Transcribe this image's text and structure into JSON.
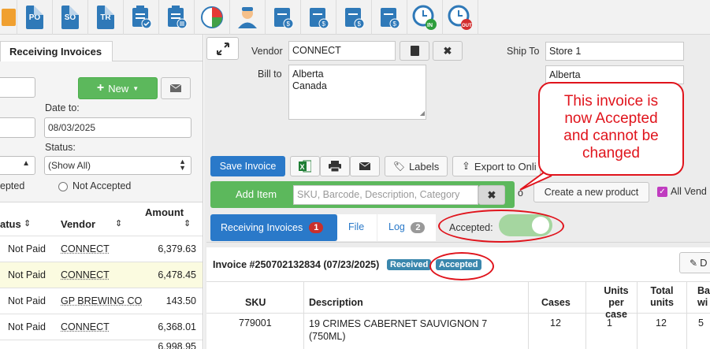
{
  "toolbar": {
    "icons": [
      "store-icon",
      "po-icon",
      "so-icon",
      "tr-icon",
      "checklist-approve-icon",
      "checklist-icon",
      "pie-chart-icon",
      "user-icon",
      "invoice-dollar-icon",
      "invoice-dollar-icon-2",
      "clock-in-icon",
      "clock-out-icon"
    ],
    "po_label": "PO",
    "so_label": "SO",
    "tr_label": "TR",
    "in_label": "IN",
    "out_label": "OUT"
  },
  "left": {
    "tab_title": "Receiving Invoices",
    "new_label": "New",
    "date_to_label": "Date to:",
    "date_to_value": "08/03/2025",
    "status_label": "Status:",
    "status_value": "(Show All)",
    "radio_accepted_partial": "epted",
    "radio_not_accepted": "Not Accepted",
    "columns": {
      "status": "atus",
      "vendor": "Vendor",
      "amount": "Amount"
    },
    "rows": [
      {
        "status": "Not Paid",
        "vendor": "CONNECT",
        "amount": "6,379.63"
      },
      {
        "status": "Not Paid",
        "vendor": "CONNECT",
        "amount": "6,478.45"
      },
      {
        "status": "Not Paid",
        "vendor": "GP BREWING CO",
        "amount": "143.50"
      },
      {
        "status": "Not Paid",
        "vendor": "CONNECT",
        "amount": "6,368.01"
      },
      {
        "status": "",
        "vendor": "",
        "amount": "6,998.95"
      }
    ]
  },
  "main": {
    "vendor_label": "Vendor",
    "vendor_value": "CONNECT",
    "bill_to_label": "Bill to",
    "bill_to_line1": "Alberta",
    "bill_to_line2": "Canada",
    "ship_to_label": "Ship To",
    "ship_to_value": "Store 1",
    "ship_to_addr": "Alberta",
    "save_label": "Save Invoice",
    "labels_label": "Labels",
    "export_label": "Export to Onli",
    "add_item_label": "Add Item",
    "search_placeholder": "SKU, Barcode, Description, Category",
    "or_label": "o",
    "create_product_label": "Create a new product",
    "all_vendors_label": "All Vend",
    "tabs": [
      {
        "label": "Receiving Invoices",
        "count": "1"
      },
      {
        "label": "File",
        "count": ""
      },
      {
        "label": "Log",
        "count": "2"
      }
    ],
    "accepted_label": "Accepted:",
    "accepted_on": true,
    "invoice_title": "Invoice #250702132834 (07/23/2025)",
    "badge_received": "Received",
    "badge_accepted": "Accepted",
    "right_btn_partial": "D",
    "table": {
      "headers": {
        "sku": "SKU",
        "description": "Description",
        "cases": "Cases",
        "units_per_case_1": "Units",
        "units_per_case_2": "per case",
        "total_units_1": "Total",
        "total_units_2": "units",
        "last_1": "Ba",
        "last_2": "wi"
      },
      "rows": [
        {
          "sku": "779001",
          "description_1": "19 CRIMES CABERNET SAUVIGNON 7",
          "description_2": "(750ML)",
          "cases": "12",
          "units_per_case": "1",
          "total_units": "12",
          "last": "5"
        }
      ]
    }
  },
  "callout": {
    "text_1": "This invoice is",
    "text_2": "now Accepted",
    "text_3": "and cannot be",
    "text_4": "changed"
  },
  "colors": {
    "accent": "#2a79c9",
    "green": "#5cb85c",
    "badge": "#3a87ad",
    "annotation": "#e0141c"
  }
}
